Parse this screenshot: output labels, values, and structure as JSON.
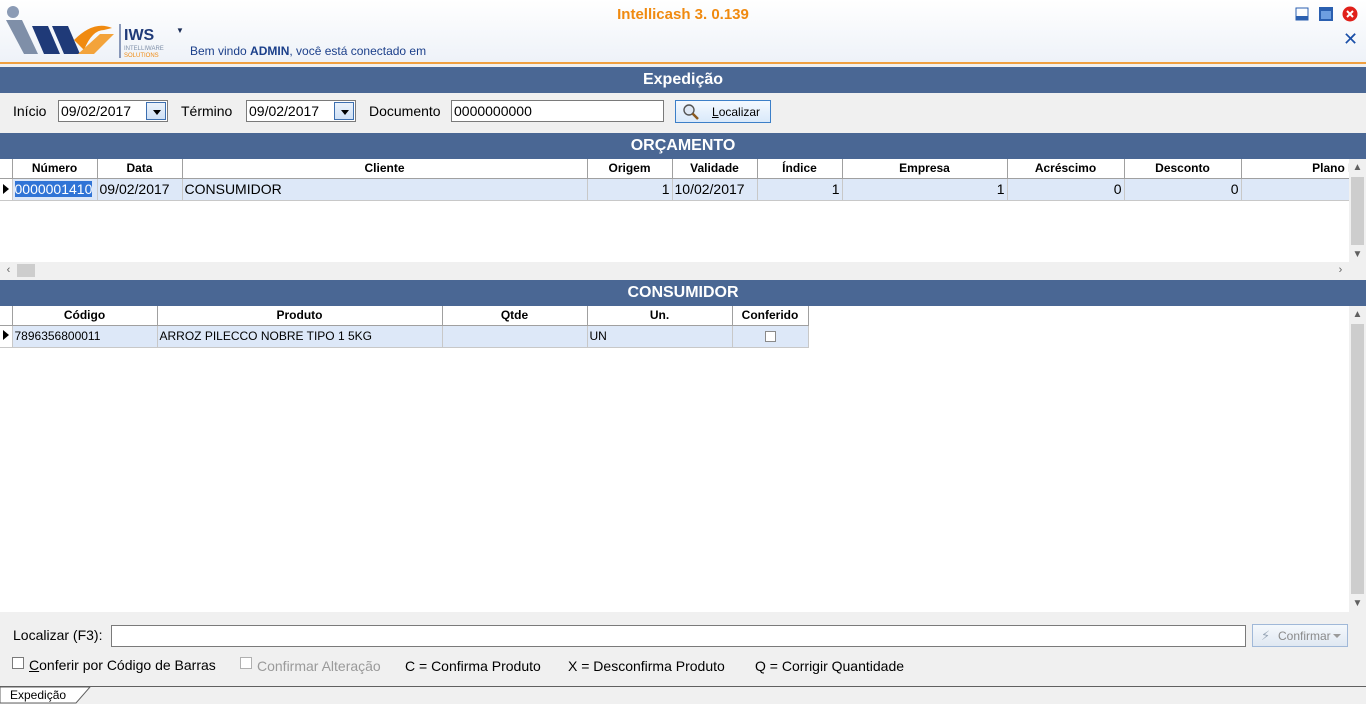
{
  "app": {
    "title": "Intellicash 3. 0.139",
    "welcome_prefix": "Bem vindo ",
    "welcome_user": "ADMIN",
    "welcome_suffix": ", você está conectado em",
    "logo_text": "IWS",
    "logo_sub1": "INTELLIWARE",
    "logo_sub2": "SOLUTIONS",
    "close_glyph": "✕"
  },
  "page": {
    "header": "Expedição"
  },
  "filters": {
    "inicio_label": "Início",
    "inicio_value": "09/02/2017",
    "termino_label": "Término",
    "termino_value": "09/02/2017",
    "documento_label": "Documento",
    "documento_value": "0000000000",
    "localizar_label_prefix": "",
    "localizar_label_u": "L",
    "localizar_label_rest": "ocalizar"
  },
  "orcamento": {
    "header": "ORÇAMENTO",
    "columns": [
      "Número",
      "Data",
      "Cliente",
      "Origem",
      "Validade",
      "Índice",
      "Empresa",
      "Acréscimo",
      "Desconto",
      "Plano Pg"
    ],
    "rows": [
      {
        "numero": "0000001410",
        "data": "09/02/2017",
        "cliente": "CONSUMIDOR",
        "origem": "1",
        "validade": "10/02/2017",
        "indice": "1",
        "empresa": "1",
        "acrescimo": "0",
        "desconto": "0",
        "plano": ""
      }
    ]
  },
  "consumidor": {
    "header": "CONSUMIDOR",
    "columns": [
      "Código",
      "Produto",
      "Qtde",
      "Un.",
      "Conferido"
    ],
    "rows": [
      {
        "codigo": "7896356800011",
        "produto": "ARROZ PILECCO NOBRE TIPO 1 5KG",
        "qtde": "",
        "un": "UN",
        "conferido": false
      }
    ]
  },
  "bottom": {
    "localizar_label": "Localizar (F3):",
    "localizar_value": "",
    "confirmar_label": "Confirmar",
    "conferir_label_u": "C",
    "conferir_label_rest": "onferir por Código de Barras",
    "confirmar_alteracao_label": "Confirmar Alteração",
    "legend_c": "C = Confirma Produto",
    "legend_x": "X =  Desconfirma Produto",
    "legend_q": "Q = Corrigir Quantidade"
  },
  "tabs": [
    {
      "label": "Expedição"
    }
  ],
  "colors": {
    "accent": "#f08a10",
    "header_bg": "#4a6794",
    "selection": "#3074d6"
  }
}
